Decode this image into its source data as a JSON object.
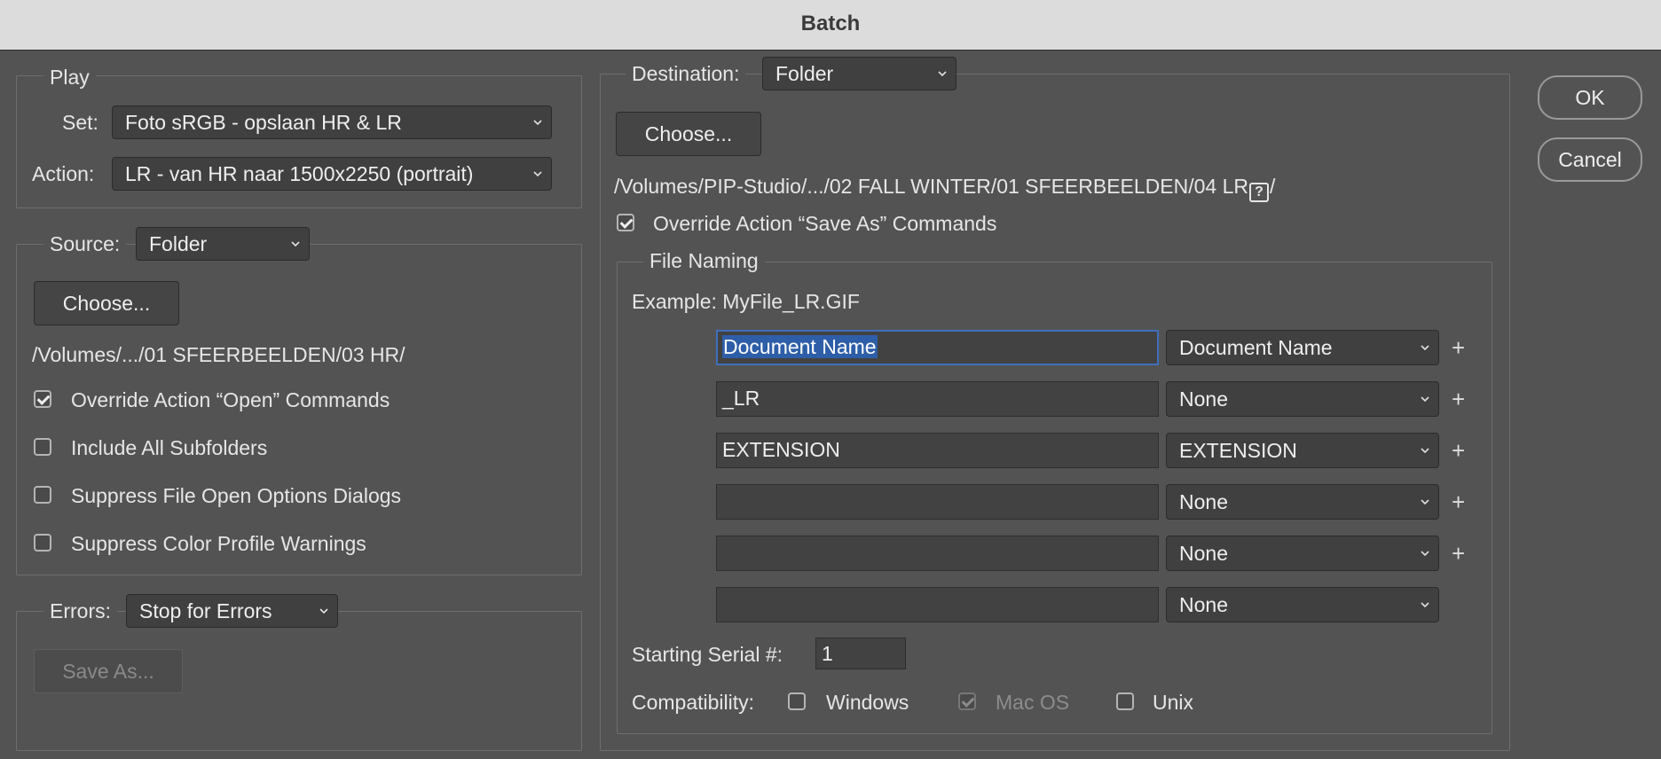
{
  "window": {
    "title": "Batch"
  },
  "play": {
    "legend": "Play",
    "set_label": "Set:",
    "set_value": "Foto sRGB - opslaan HR & LR",
    "action_label": "Action:",
    "action_value": "LR - van HR naar 1500x2250 (portrait)"
  },
  "source": {
    "label": "Source:",
    "value": "Folder",
    "choose_label": "Choose...",
    "path": "/Volumes/.../01 SFEERBEELDEN/03 HR/",
    "options": [
      {
        "label": "Override Action “Open” Commands",
        "checked": true
      },
      {
        "label": "Include All Subfolders",
        "checked": false
      },
      {
        "label": "Suppress File Open Options Dialogs",
        "checked": false
      },
      {
        "label": "Suppress Color Profile Warnings",
        "checked": false
      }
    ]
  },
  "errors": {
    "label": "Errors:",
    "value": "Stop for Errors",
    "save_as_label": "Save As..."
  },
  "destination": {
    "label": "Destination:",
    "value": "Folder",
    "choose_label": "Choose...",
    "path_prefix": "/Volumes/PIP-Studio/.../02 FALL WINTER/01 SFEERBEELDEN/04 LR",
    "path_icon": "?",
    "path_suffix": "/",
    "override_label": "Override Action “Save As” Commands",
    "override_checked": true
  },
  "file_naming": {
    "legend": "File Naming",
    "example_label": "Example: MyFile_LR.GIF",
    "rows": [
      {
        "text": "Document Name",
        "select": "Document Name",
        "has_plus": true
      },
      {
        "text": "_LR",
        "select": "None",
        "has_plus": true
      },
      {
        "text": "EXTENSION",
        "select": "EXTENSION",
        "has_plus": true
      },
      {
        "text": "",
        "select": "None",
        "has_plus": true
      },
      {
        "text": "",
        "select": "None",
        "has_plus": true
      },
      {
        "text": "",
        "select": "None",
        "has_plus": false
      }
    ],
    "plus_symbol": "+",
    "serial_label": "Starting Serial #:",
    "serial_value": "1",
    "compat_label": "Compatibility:",
    "compat": [
      {
        "label": "Windows",
        "checked": false,
        "disabled": false
      },
      {
        "label": "Mac OS",
        "checked": true,
        "disabled": true
      },
      {
        "label": "Unix",
        "checked": false,
        "disabled": false
      }
    ]
  },
  "buttons": {
    "ok": "OK",
    "cancel": "Cancel"
  }
}
